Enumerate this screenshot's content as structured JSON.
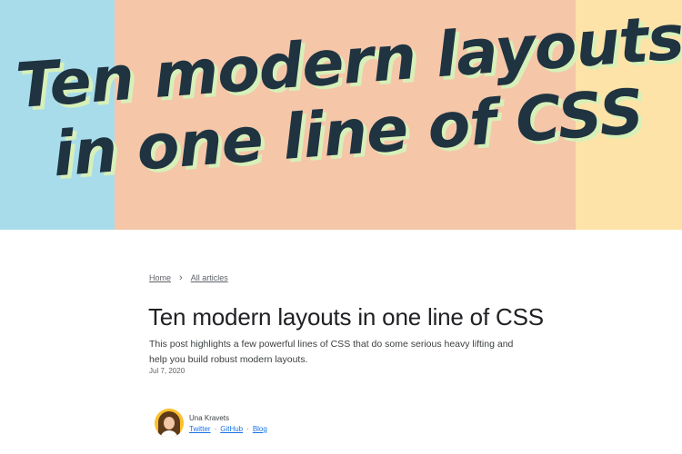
{
  "hero": {
    "line1": "Ten modern layouts",
    "line2": "in one line of CSS",
    "colors": {
      "stripe_left": "#a8dcea",
      "stripe_middle": "#f5c6a8",
      "stripe_right": "#fde3a7",
      "text": "#1f3340",
      "shadow": "#d7f0b9"
    }
  },
  "breadcrumb": {
    "home": "Home",
    "separator": "›",
    "all_articles": "All articles"
  },
  "article": {
    "title": "Ten modern layouts in one line of CSS",
    "subtitle": "This post highlights a few powerful lines of CSS that do some serious heavy lifting and help you build robust modern layouts.",
    "date": "Jul 7, 2020"
  },
  "author": {
    "name": "Una Kravets",
    "links": {
      "twitter": "Twitter",
      "github": "GitHub",
      "blog": "Blog"
    },
    "separator": "·"
  }
}
